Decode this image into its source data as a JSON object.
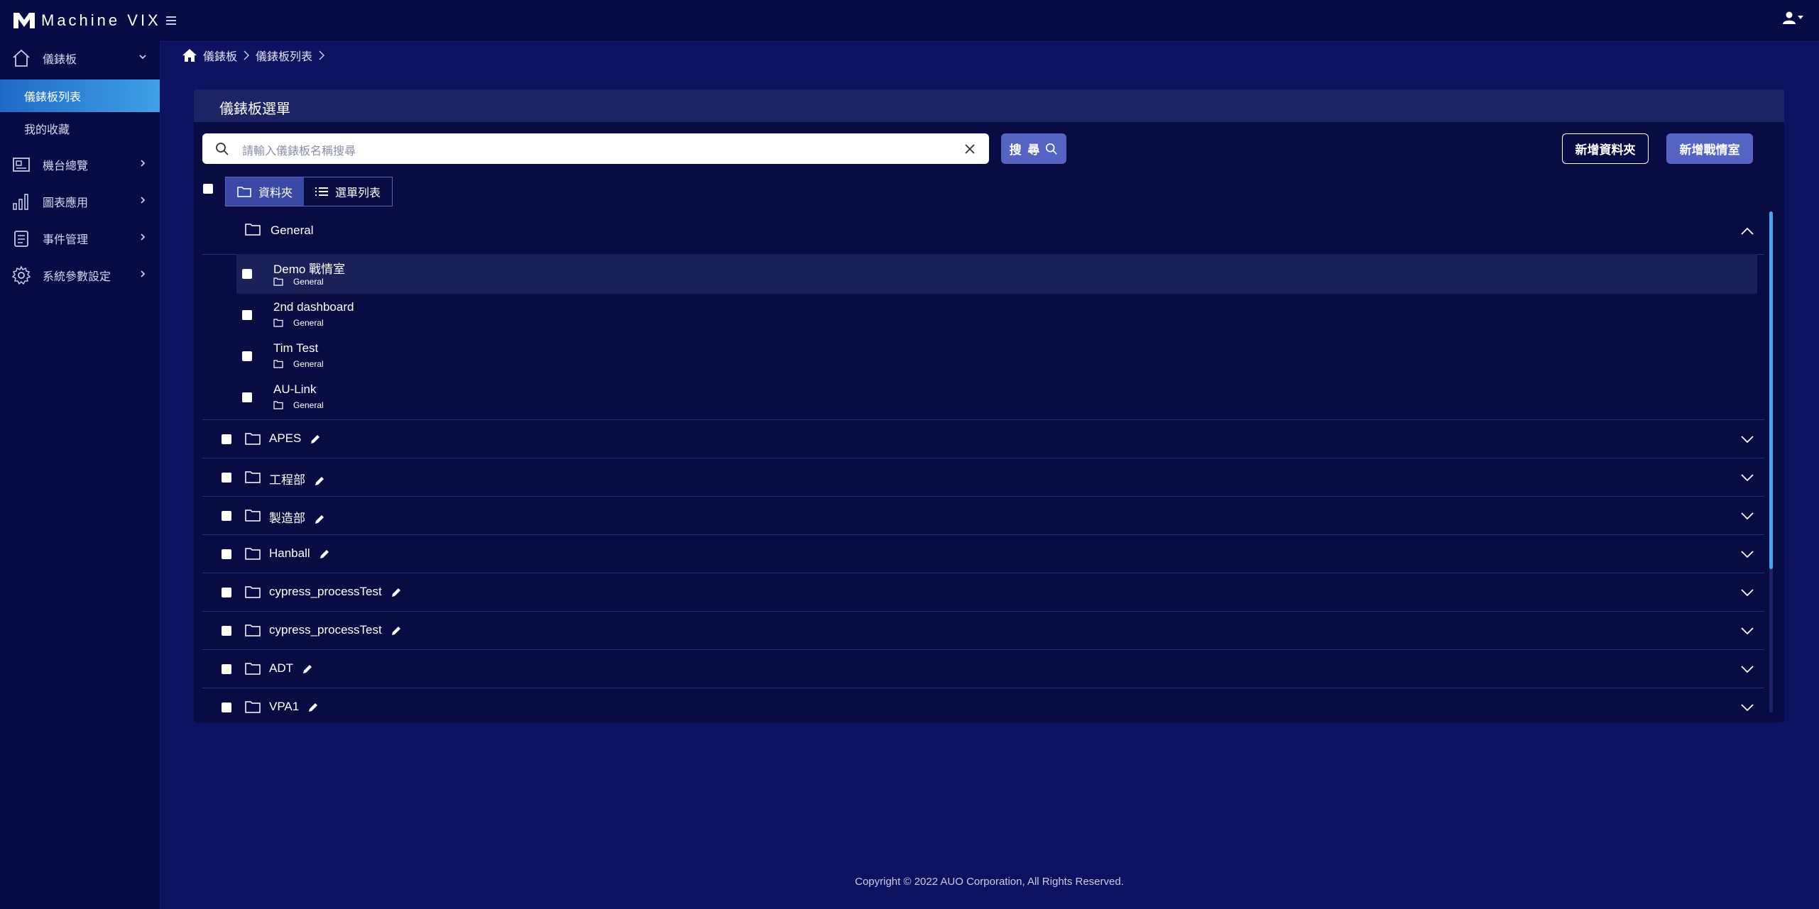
{
  "app": {
    "logo_text": "Machine VIX"
  },
  "sidebar": {
    "items": [
      {
        "label": "儀錶板",
        "icon": "home-icon"
      },
      {
        "label": "機台總覽",
        "icon": "machine-icon"
      },
      {
        "label": "圖表應用",
        "icon": "bar-chart-icon"
      },
      {
        "label": "事件管理",
        "icon": "clipboard-icon"
      },
      {
        "label": "系統參數設定",
        "icon": "gear-icon"
      }
    ],
    "sub_items": [
      {
        "label": "儀錶板列表",
        "active": true
      },
      {
        "label": "我的收藏",
        "active": false
      }
    ]
  },
  "breadcrumb": {
    "items": [
      "儀錶板",
      "儀錶板列表"
    ]
  },
  "panel": {
    "title": "儀錶板選單",
    "search_placeholder": "請輸入儀錶板名稱搜尋",
    "search_button": "搜 尋",
    "new_folder_button": "新增資料夾",
    "new_room_button": "新增戰情室",
    "view_folder": "資料夾",
    "view_list": "選單列表"
  },
  "open_group": {
    "name": "General",
    "items": [
      {
        "name": "Demo 戰情室",
        "folder": "General"
      },
      {
        "name": "2nd dashboard",
        "folder": "General"
      },
      {
        "name": "Tim Test",
        "folder": "General"
      },
      {
        "name": "AU-Link",
        "folder": "General"
      }
    ]
  },
  "groups": [
    {
      "name": "APES"
    },
    {
      "name": "工程部"
    },
    {
      "name": "製造部"
    },
    {
      "name": "Hanball"
    },
    {
      "name": "cypress_processTest"
    },
    {
      "name": "cypress_processTest"
    },
    {
      "name": "ADT"
    },
    {
      "name": "VPA1"
    }
  ],
  "footer": {
    "copyright": "Copyright © 2022 AUO Corporation, All Rights Reserved."
  },
  "colors": {
    "background": "#0d1260",
    "sidebar": "#070b45",
    "accent": "#5563c2",
    "active_nav": "#3fa0e6"
  }
}
